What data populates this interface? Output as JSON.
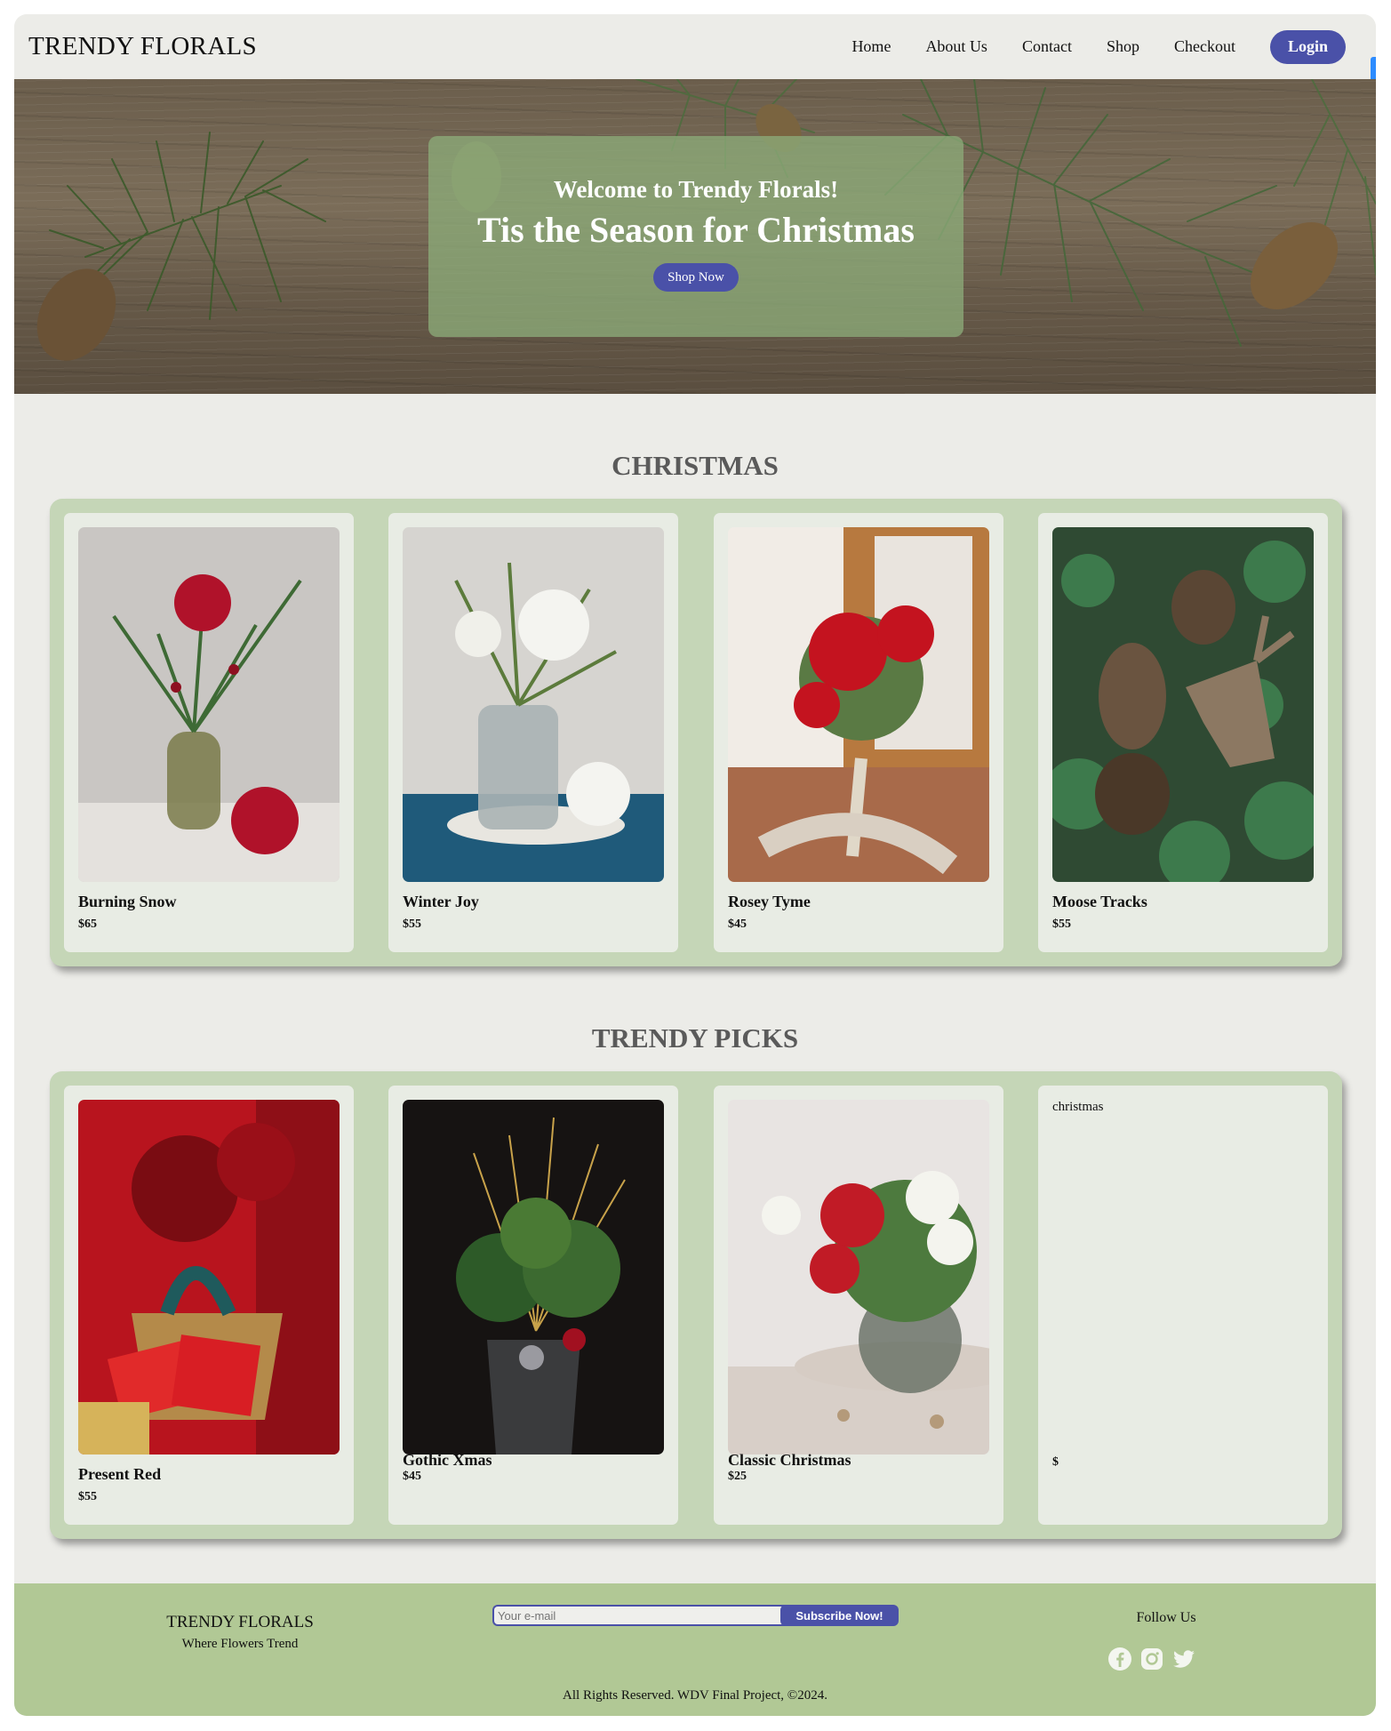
{
  "nav": {
    "brand": "TRENDY FLORALS",
    "links": [
      "Home",
      "About Us",
      "Contact",
      "Shop",
      "Checkout"
    ],
    "login": "Login"
  },
  "hero": {
    "welcome": "Welcome to Trendy Florals!",
    "title": "Tis the Season for Christmas",
    "cta": "Shop Now"
  },
  "christmas": {
    "title": "CHRISTMAS",
    "items": [
      {
        "name": "Burning Snow",
        "price": "$65"
      },
      {
        "name": "Winter Joy",
        "price": "$55"
      },
      {
        "name": "Rosey Tyme",
        "price": "$45"
      },
      {
        "name": "Moose Tracks",
        "price": "$55"
      }
    ]
  },
  "trendy": {
    "title": "TRENDY PICKS",
    "items": [
      {
        "name": "Present Red",
        "price": "$55"
      },
      {
        "name": "Gothic Xmas",
        "price": "$45"
      },
      {
        "name": "Classic Christmas",
        "price": "$25"
      },
      {
        "name": "",
        "price": "$",
        "image_alt": "christmas"
      }
    ]
  },
  "footer": {
    "brand": "TRENDY FLORALS",
    "tagline": "Where Flowers Trend",
    "email_placeholder": "Your e-mail",
    "subscribe": "Subscribe Now!",
    "follow": "Follow Us",
    "social_icons": [
      "facebook-icon",
      "instagram-icon",
      "twitter-icon"
    ],
    "copyright": "All Rights Reserved. WDV Final Project, ©2024."
  },
  "colors": {
    "accent": "#4a51a8",
    "panel": "#c5d6b7",
    "card": "#e8ece4",
    "footer": "#b1c895",
    "page": "#ecece8"
  }
}
